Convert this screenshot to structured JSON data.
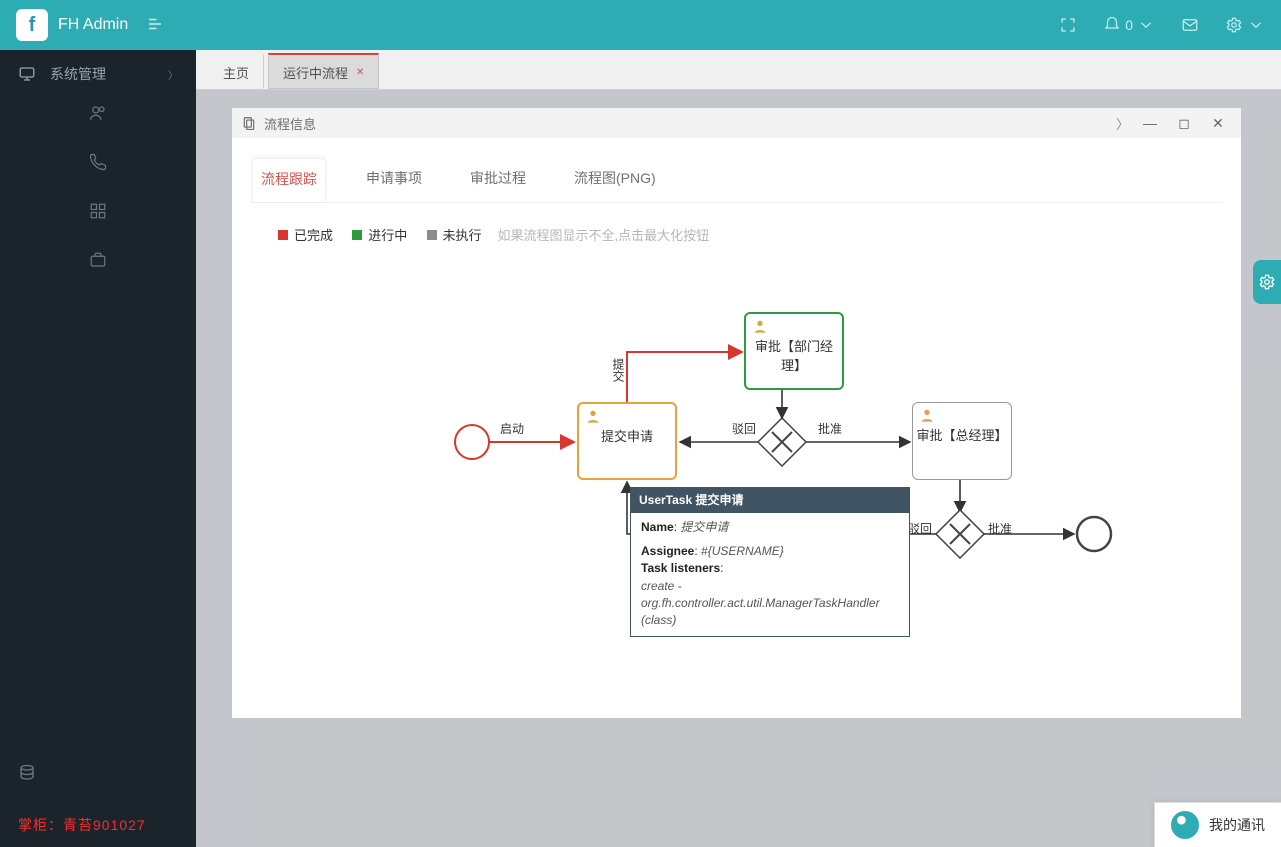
{
  "header": {
    "brand": "FH Admin",
    "notif_badge": "0"
  },
  "sidebar": {
    "items": [
      {
        "icon": "monitor",
        "label": "系统管理"
      },
      {
        "icon": "users",
        "label": ""
      },
      {
        "icon": "phone",
        "label": ""
      },
      {
        "icon": "grid",
        "label": ""
      },
      {
        "icon": "briefcase",
        "label": ""
      }
    ],
    "bottom_icon": "database",
    "watermark": "掌柜：青苔901027"
  },
  "tabs": {
    "home": "主页",
    "active": "运行中流程"
  },
  "modal": {
    "title": "流程信息",
    "inner_tabs": [
      "流程跟踪",
      "申请事项",
      "审批过程",
      "流程图(PNG)"
    ],
    "active_inner_tab": "流程跟踪",
    "legend": {
      "done": {
        "color": "#d9362d",
        "label": "已完成"
      },
      "doing": {
        "color": "#2e9b3d",
        "label": "进行中"
      },
      "todo": {
        "color": "#8c8c8c",
        "label": "未执行"
      },
      "hint": "如果流程图显示不全,点击最大化按钮"
    }
  },
  "diagram": {
    "edges": {
      "start": "启动",
      "submit": "提交",
      "reject1": "驳回",
      "approve1": "批准",
      "reject2": "驳回",
      "approve2": "批准"
    },
    "tasks": {
      "submit": "提交申请",
      "dept": "审批【部门经理】",
      "gm": "审批【总经理】"
    },
    "tooltip": {
      "header": "UserTask 提交申请",
      "name_label": "Name",
      "name_value": "提交申请",
      "assignee_label": "Assignee",
      "assignee_value": "#{USERNAME}",
      "listeners_label": "Task listeners",
      "listeners_value": "create - org.fh.controller.act.util.ManagerTaskHandler (class)"
    }
  },
  "chat": {
    "label": "我的通讯"
  }
}
